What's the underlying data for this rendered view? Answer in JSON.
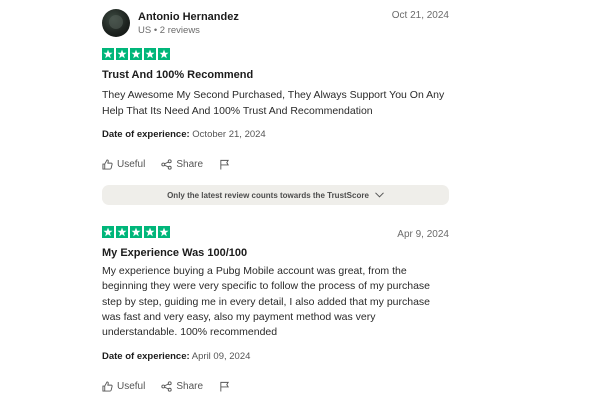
{
  "colors": {
    "star_green": "#00b67a",
    "notice_bg": "#efeeea",
    "muted_text": "#6b6b6b"
  },
  "reviews": [
    {
      "reviewer_name": "Antonio Hernandez",
      "reviewer_meta": "US • 2 reviews",
      "date": "Oct 21, 2024",
      "rating": 5,
      "title": "Trust And 100% Recommend",
      "body": "They Awesome My Second Purchased, They Always Support You On Any Help That Its Need And 100% Trust And Recommendation",
      "experience_label": "Date of experience:",
      "experience_date": "October 21, 2024",
      "useful_label": "Useful",
      "share_label": "Share",
      "icons": [
        "thumbs-up-icon",
        "share-icon",
        "flag-icon"
      ]
    },
    {
      "date": "Apr 9, 2024",
      "rating": 5,
      "title": "My Experience Was 100/100",
      "body": "My experience buying a Pubg Mobile account was great, from the beginning they were very specific to follow the process of my purchase step by step, guiding me in every detail, I also added that my purchase was fast and very easy, also my payment method was very understandable. 100% recommended",
      "experience_label": "Date of experience:",
      "experience_date": "April 09, 2024",
      "useful_label": "Useful",
      "share_label": "Share",
      "icons": [
        "thumbs-up-icon",
        "share-icon",
        "flag-icon"
      ]
    }
  ],
  "notice": {
    "text": "Only the latest review counts towards the TrustScore",
    "icon": "chevron-down-icon"
  }
}
